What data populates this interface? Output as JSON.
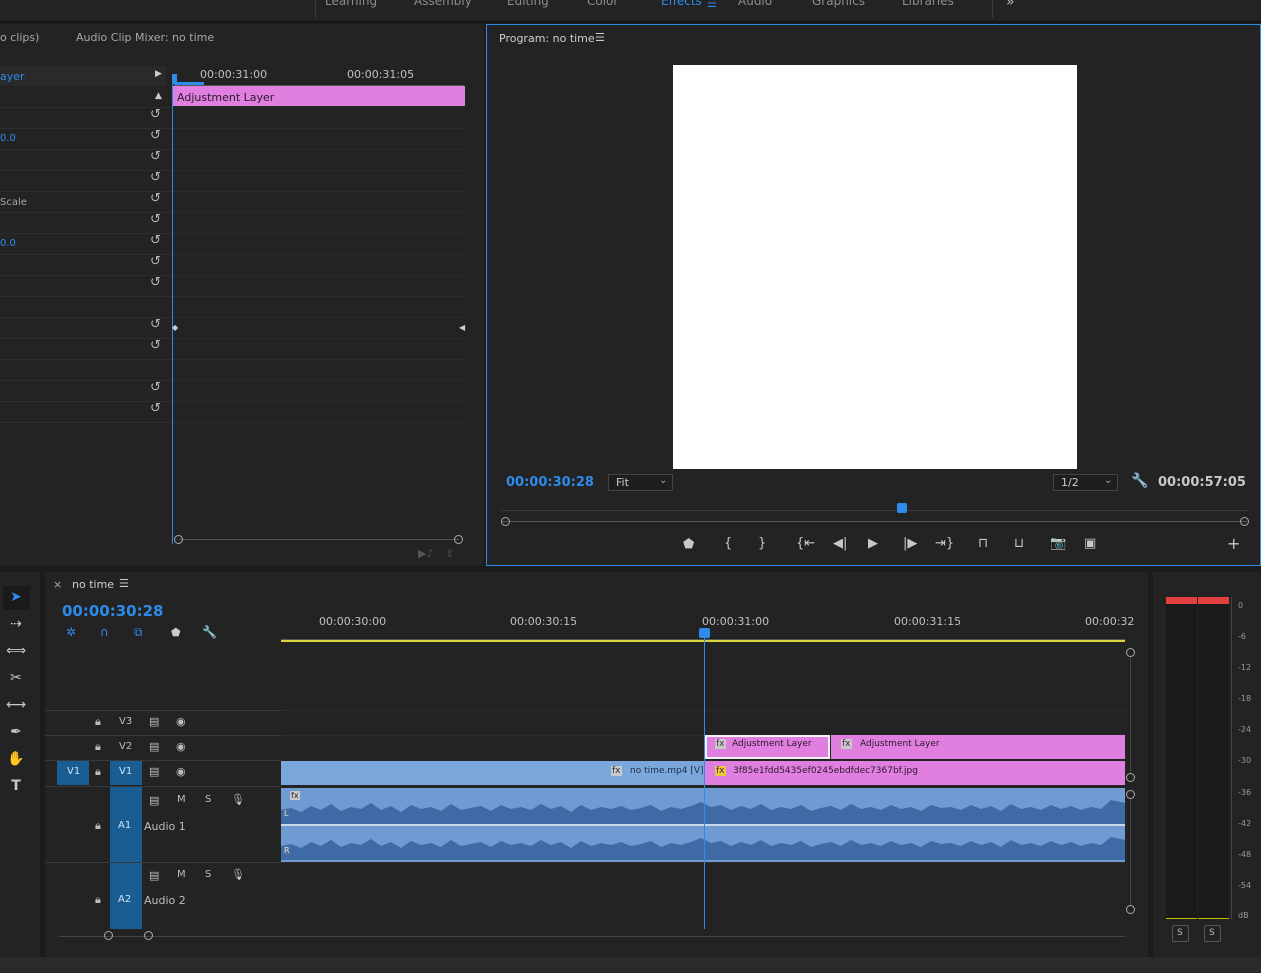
{
  "workspaces": [
    "Learning",
    "Assembly",
    "Editing",
    "Color",
    "Effects",
    "Audio",
    "Graphics",
    "Libraries"
  ],
  "overflow_label": "»",
  "left_panel": {
    "tabs": [
      "o clips)",
      "Audio Clip Mixer: no time"
    ],
    "clip_label": "ayer",
    "times": [
      "00:00:31:00",
      "00:00:31:05"
    ],
    "adj_clip": "Adjustment Layer",
    "param_vals": [
      "0.0",
      "Scale",
      "0.0"
    ]
  },
  "program": {
    "title": "Program: no time",
    "timecode": "00:00:30:28",
    "fit": "Fit",
    "res": "1/2",
    "duration": "00:00:57:05",
    "add": "+"
  },
  "sequence": {
    "close": "×",
    "name": "no time",
    "timecode": "00:00:30:28",
    "ruler": [
      "00:00:30:00",
      "00:00:30:15",
      "00:00:31:00",
      "00:00:31:15",
      "00:00:32"
    ],
    "tracks": {
      "v3": "V3",
      "v2": "V2",
      "v1": "V1",
      "v1_src": "V1",
      "a1": "A1",
      "a1_name": "Audio 1",
      "a2": "A2",
      "a2_name": "Audio 2",
      "m": "M",
      "s": "S"
    },
    "clips": {
      "adj1": "Adjustment Layer",
      "adj2": "Adjustment Layer",
      "video": "no time.mp4 [V]",
      "image": "3f85e1fdd5435ef0245ebdfdec7367bf.jpg",
      "fx": "fx",
      "L": "L",
      "R": "R"
    }
  },
  "meter": {
    "scale": [
      "0",
      "-6",
      "-12",
      "-18",
      "-24",
      "-30",
      "-36",
      "-42",
      "-48",
      "-54",
      "dB"
    ],
    "solo": [
      "S",
      "S"
    ]
  },
  "colors": {
    "accent": "#2d8ceb",
    "pink": "#e07fe0",
    "audio": "#6f9bd2",
    "video": "#7ba7dc"
  }
}
